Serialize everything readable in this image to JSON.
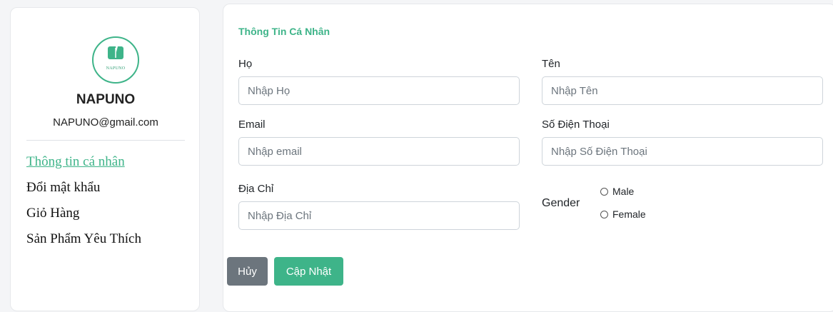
{
  "profile": {
    "brand": "NAPUNO",
    "email": "NAPUNO@gmail.com",
    "logo_text": "NAPUNO",
    "menu": [
      {
        "label": "Thông tin cá nhân",
        "active": true
      },
      {
        "label": "Đổi mật khẩu",
        "active": false
      },
      {
        "label": "Giỏ Hàng",
        "active": false
      },
      {
        "label": "Sản Phẩm Yêu Thích",
        "active": false
      }
    ]
  },
  "form": {
    "title": "Thông Tin Cá Nhân",
    "last_name": {
      "label": "Họ",
      "placeholder": "Nhập Họ",
      "value": ""
    },
    "first_name": {
      "label": "Tên",
      "placeholder": "Nhập Tên",
      "value": ""
    },
    "email": {
      "label": "Email",
      "placeholder": "Nhập email",
      "value": ""
    },
    "phone": {
      "label": "Số Điện Thoại",
      "placeholder": "Nhập Số Điện Thoại",
      "value": ""
    },
    "address": {
      "label": "Địa Chỉ",
      "placeholder": "Nhập Địa Chỉ",
      "value": ""
    },
    "gender": {
      "label": "Gender",
      "options": [
        "Male",
        "Female"
      ],
      "selected": null
    }
  },
  "buttons": {
    "cancel": "Hủy",
    "update": "Cập Nhật"
  },
  "colors": {
    "accent": "#3eb489",
    "secondary": "#6c757d",
    "border": "#ced4da"
  }
}
